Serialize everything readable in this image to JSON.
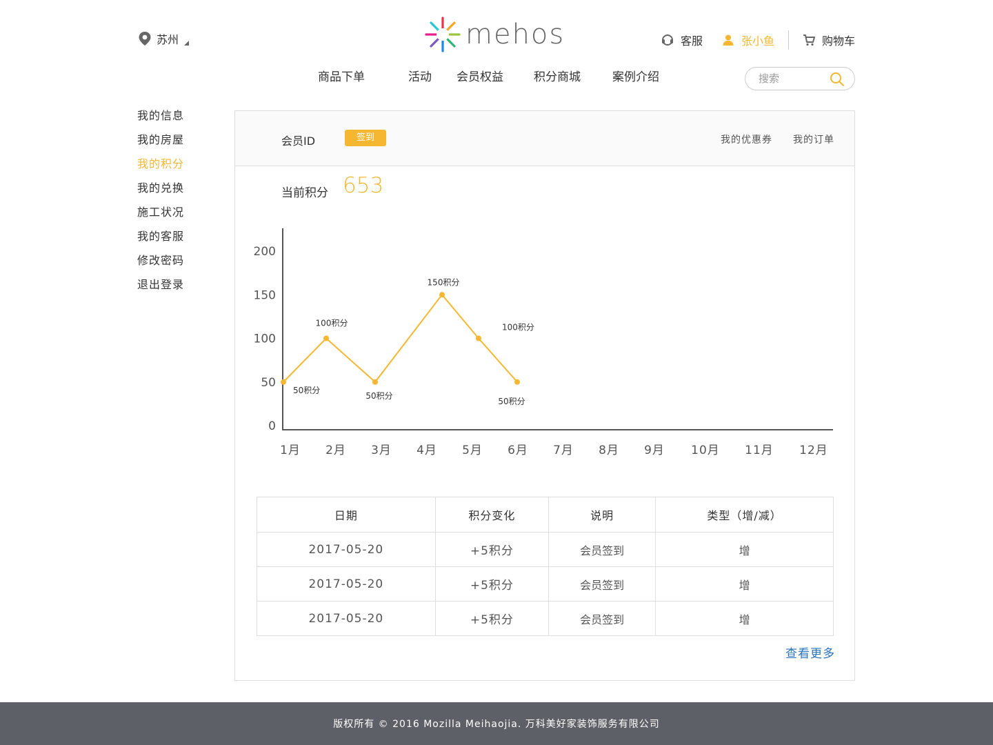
{
  "header": {
    "location": "苏州",
    "logo_text": "mehos",
    "service_label": "客服",
    "user_name": "张小鱼",
    "cart_label": "购物车"
  },
  "nav": {
    "items": [
      {
        "label": "商品下单"
      },
      {
        "label": "活动"
      },
      {
        "label": "会员权益"
      },
      {
        "label": "积分商城"
      },
      {
        "label": "案例介绍"
      }
    ]
  },
  "search": {
    "placeholder": "搜索"
  },
  "sidebar": {
    "items": [
      {
        "label": "我的信息",
        "active": false
      },
      {
        "label": "我的房屋",
        "active": false
      },
      {
        "label": "我的积分",
        "active": true
      },
      {
        "label": "我的兑换",
        "active": false
      },
      {
        "label": "施工状况",
        "active": false
      },
      {
        "label": "我的客服",
        "active": false
      },
      {
        "label": "修改密码",
        "active": false
      },
      {
        "label": "退出登录",
        "active": false
      }
    ]
  },
  "panel": {
    "member_id_label": "会员ID",
    "checkin_label": "签到",
    "coupons_label": "我的优惠券",
    "orders_label": "我的订单",
    "points_label": "当前积分",
    "points_value": "653"
  },
  "chart_data": {
    "type": "line",
    "categories": [
      "1月",
      "2月",
      "3月",
      "4月",
      "5月",
      "6月",
      "7月",
      "8月",
      "9月",
      "10月",
      "11月",
      "12月"
    ],
    "values": [
      50,
      100,
      50,
      150,
      100,
      50
    ],
    "data_labels": [
      "50积分",
      "100积分",
      "50积分",
      "150积分",
      "100积分",
      "50积分"
    ],
    "y_ticks": [
      0,
      50,
      100,
      150,
      200
    ],
    "ylim": [
      0,
      200
    ],
    "grid": false,
    "line_color": "#f5b731",
    "title": "",
    "xlabel": "",
    "ylabel": ""
  },
  "table": {
    "headers": [
      "日期",
      "积分变化",
      "说明",
      "类型（增/减）"
    ],
    "rows": [
      [
        "2017-05-20",
        "+5积分",
        "会员签到",
        "增"
      ],
      [
        "2017-05-20",
        "+5积分",
        "会员签到",
        "增"
      ],
      [
        "2017-05-20",
        "+5积分",
        "会员签到",
        "增"
      ]
    ]
  },
  "more_label": "查看更多",
  "footer": {
    "text": "版权所有 © 2016 Mozilla Meihaojia. 万科美好家装饰服务有限公司"
  },
  "colors": {
    "accent": "#f5b731",
    "link": "#2a73b8",
    "footer_bg": "#5d6067"
  }
}
